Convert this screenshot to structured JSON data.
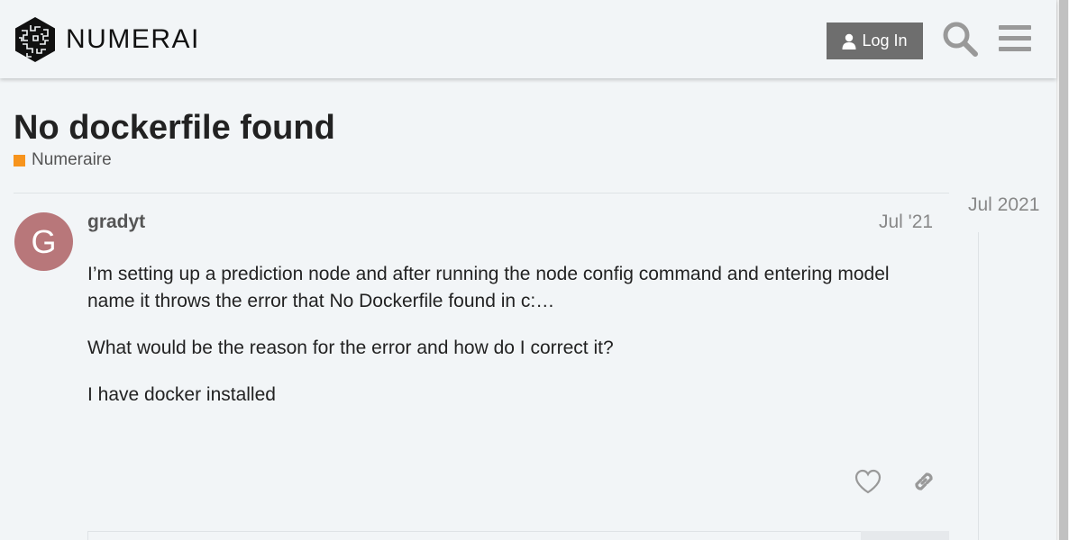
{
  "header": {
    "logo_text": "NUMERAI",
    "login_label": "Log In",
    "icons": [
      "numerai-logo-icon",
      "user-icon",
      "search-icon",
      "hamburger-menu-icon"
    ]
  },
  "topic": {
    "title": "No dockerfile found",
    "category": "Numeraire",
    "category_color": "#f7941d"
  },
  "post": {
    "avatar_letter": "G",
    "avatar_color": "#b8777a",
    "username": "gradyt",
    "date": "Jul '21",
    "paragraphs": [
      "I’m setting up a prediction node and after running the node config command and entering model name it throws the error that No Dockerfile found in c:…",
      "What would be the reason for the error and how do I correct it?",
      "I have docker installed"
    ],
    "actions": [
      "like-icon",
      "link-icon"
    ]
  },
  "timeline": {
    "date": "Jul 2021"
  }
}
